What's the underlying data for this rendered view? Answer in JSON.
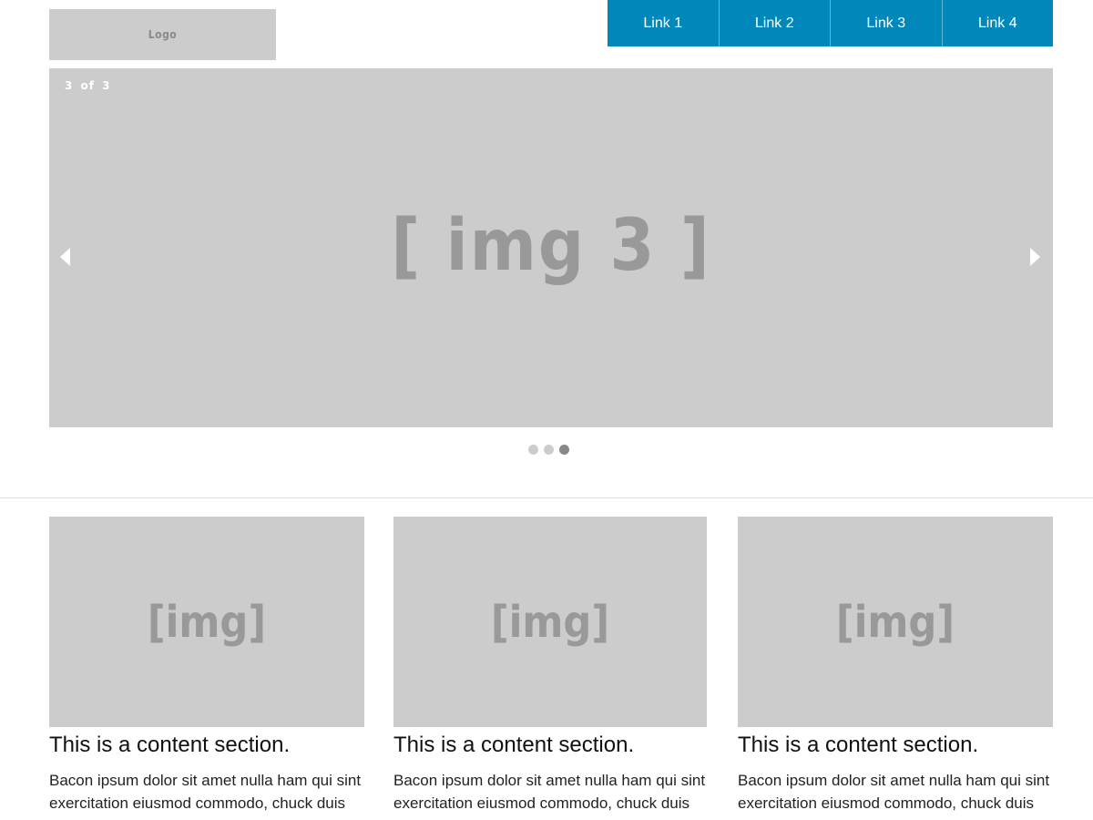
{
  "header": {
    "logo_text": "Logo",
    "nav": [
      {
        "label": "Link 1"
      },
      {
        "label": "Link 2"
      },
      {
        "label": "Link 3"
      },
      {
        "label": "Link 4"
      }
    ]
  },
  "slider": {
    "counter": "3 of 3",
    "image_label": "[ img 3 ]",
    "current_slide": 3,
    "total_slides": 3
  },
  "cards": [
    {
      "image_label": "[img]",
      "title": "This is a content section.",
      "text": "Bacon ipsum dolor sit amet nulla ham qui sint exercitation eiusmod commodo, chuck duis velit. Aute in reprehenderit. Labore"
    },
    {
      "image_label": "[img]",
      "title": "This is a content section.",
      "text": "Bacon ipsum dolor sit amet nulla ham qui sint exercitation eiusmod commodo, chuck duis velit. Aute in reprehenderit. Labore"
    },
    {
      "image_label": "[img]",
      "title": "This is a content section.",
      "text": "Bacon ipsum dolor sit amet nulla ham qui sint exercitation eiusmod commodo, chuck duis velit. Aute in reprehenderit. Labore"
    }
  ],
  "colors": {
    "nav_background": "#0088bb",
    "placeholder": "#cccccc",
    "placeholder_text": "#999999",
    "dot_active": "#888888"
  }
}
